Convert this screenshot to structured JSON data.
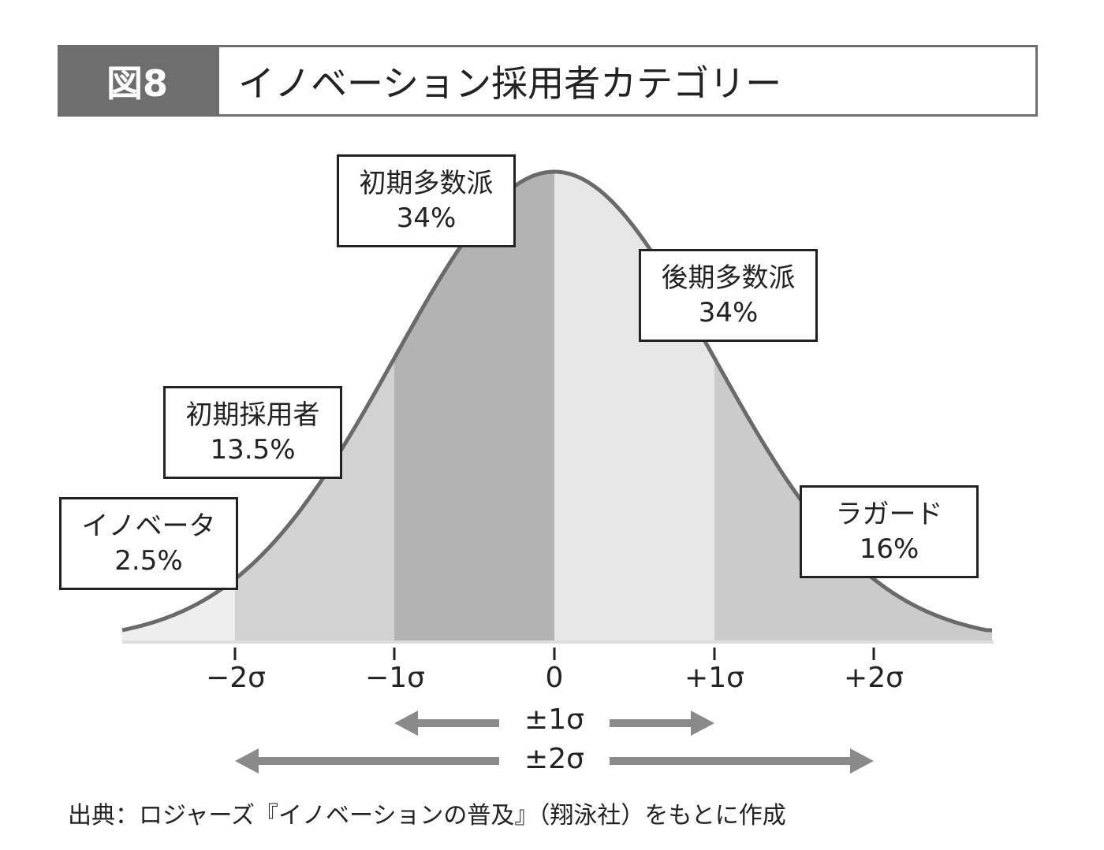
{
  "header": {
    "figure_number": "図8",
    "title": "イノベーション採用者カテゴリー"
  },
  "categories": [
    {
      "name": "イノベータ",
      "percent": "2.5%"
    },
    {
      "name": "初期採用者",
      "percent": "13.5%"
    },
    {
      "name": "初期多数派",
      "percent": "34%"
    },
    {
      "name": "後期多数派",
      "percent": "34%"
    },
    {
      "name": "ラガード",
      "percent": "16%"
    }
  ],
  "axis_ticks": [
    "−2σ",
    "−1σ",
    "0",
    "+1σ",
    "+2σ"
  ],
  "ranges": [
    "±1σ",
    "±2σ"
  ],
  "source": "出典：ロジャーズ『イノベーションの普及』（翔泳社）をもとに作成",
  "colors": {
    "header_tag_bg": "#6e6e6e",
    "innovators_fill": "#eeeeee",
    "early_adopters_fill": "#d2d2d2",
    "early_majority_fill": "#b3b3b3",
    "late_majority_fill": "#e6e6e6",
    "laggards_fill": "#cbcbcb",
    "curve_stroke": "#6a6a6a",
    "arrow": "#8a8a8a"
  }
}
